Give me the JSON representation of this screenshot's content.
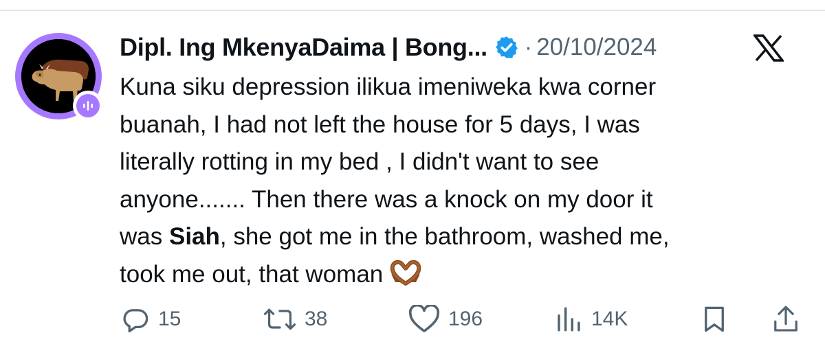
{
  "tweet": {
    "author_name": "Dipl. Ing MkenyaDaima | Bong...",
    "separator": "·",
    "date": "20/10/2024",
    "text_lines": [
      "Kuna siku depression ilikua imeniweka kwa corner",
      "buanah, I had not left the house for 5 days, I was",
      "literally rotting in my bed , I didn't want to see",
      "anyone....... Then there was a knock on my door it"
    ],
    "line5_before": "was ",
    "line5_bold": "Siah",
    "line5_after": ", she got me in the bathroom, washed me,",
    "line6": "took me out, that woman"
  },
  "actions": {
    "replies": "15",
    "reposts": "38",
    "likes": "196",
    "views": "14K"
  },
  "icons": {
    "verified": "verified-badge-icon",
    "x_logo": "x-logo-icon",
    "reply": "reply-icon",
    "repost": "repost-icon",
    "like": "heart-icon",
    "views": "views-icon",
    "bookmark": "bookmark-icon",
    "share": "share-icon",
    "emoji": "heart-hands-emoji"
  },
  "colors": {
    "text": "#0f1419",
    "secondary": "#536471",
    "verified": "#1d9bf0",
    "avatar_ring": "#a678ff"
  }
}
